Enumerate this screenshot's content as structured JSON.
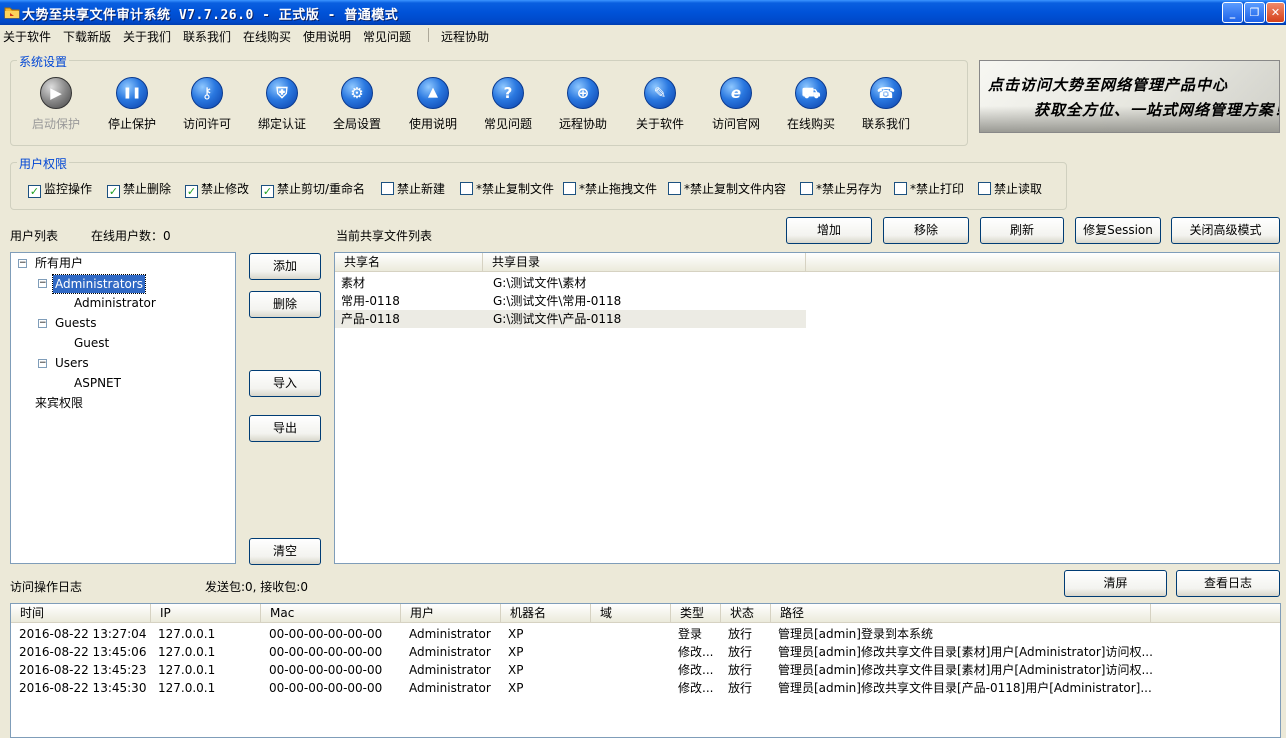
{
  "window": {
    "title": "大势至共享文件审计系统 V7.7.26.0 - 正式版 - 普通模式",
    "minimize": "_",
    "restore": "❐",
    "close": "✕"
  },
  "menu": {
    "items": [
      "关于软件",
      "下载新版",
      "关于我们",
      "联系我们",
      "在线购买",
      "使用说明",
      "常见问题",
      "远程协助"
    ]
  },
  "settings": {
    "group_title": "系统设置",
    "tools": [
      {
        "label": "启动保护",
        "icon": "play-icon",
        "glyph": "▶",
        "disabled": true
      },
      {
        "label": "停止保护",
        "icon": "pause-icon",
        "glyph": "❚❚",
        "disabled": false
      },
      {
        "label": "访问许可",
        "icon": "key-icon",
        "glyph": "⚷",
        "disabled": false
      },
      {
        "label": "绑定认证",
        "icon": "shield-icon",
        "glyph": "⛨",
        "disabled": false
      },
      {
        "label": "全局设置",
        "icon": "gear-icon",
        "glyph": "⚙",
        "disabled": false
      },
      {
        "label": "使用说明",
        "icon": "graduation-cap-icon",
        "glyph": "🎓",
        "disabled": false
      },
      {
        "label": "常见问题",
        "icon": "help-icon",
        "glyph": "?",
        "disabled": false
      },
      {
        "label": "远程协助",
        "icon": "globe-icon",
        "glyph": "⊕",
        "disabled": false
      },
      {
        "label": "关于软件",
        "icon": "document-icon",
        "glyph": "✎",
        "disabled": false
      },
      {
        "label": "访问官网",
        "icon": "ie-browser-icon",
        "glyph": "e",
        "disabled": false
      },
      {
        "label": "在线购买",
        "icon": "cart-icon",
        "glyph": "⛟",
        "disabled": false
      },
      {
        "label": "联系我们",
        "icon": "phone-icon",
        "glyph": "☎",
        "disabled": false
      }
    ]
  },
  "banner": {
    "line1": "点击访问大势至网络管理产品中心",
    "line2": "获取全方位、一站式网络管理方案！"
  },
  "permissions": {
    "group_title": "用户权限",
    "items": [
      {
        "label": "监控操作",
        "checked": true
      },
      {
        "label": "禁止删除",
        "checked": true
      },
      {
        "label": "禁止修改",
        "checked": true
      },
      {
        "label": "禁止剪切/重命名",
        "checked": true
      },
      {
        "label": "禁止新建",
        "checked": false
      },
      {
        "label": "*禁止复制文件",
        "checked": false
      },
      {
        "label": "*禁止拖拽文件",
        "checked": false
      },
      {
        "label": "*禁止复制文件内容",
        "checked": false
      },
      {
        "label": "*禁止另存为",
        "checked": false
      },
      {
        "label": "*禁止打印",
        "checked": false
      },
      {
        "label": "禁止读取",
        "checked": false
      }
    ]
  },
  "users": {
    "title": "用户列表",
    "online": "在线用户数：0",
    "tree": {
      "root": "所有用户",
      "groups": [
        {
          "name": "Administrators",
          "members": [
            "Administrator"
          ]
        },
        {
          "name": "Guests",
          "members": [
            "Guest"
          ]
        },
        {
          "name": "Users",
          "members": [
            "ASPNET"
          ]
        }
      ],
      "guest_rights": "来宾权限"
    },
    "buttons": {
      "add": "添加",
      "delete": "删除",
      "import": "导入",
      "export": "导出",
      "clear": "清空"
    }
  },
  "shares": {
    "title": "当前共享文件列表",
    "buttons": {
      "add": "增加",
      "remove": "移除",
      "refresh": "刷新",
      "fix_session": "修复Session",
      "close_advanced": "关闭高级模式"
    },
    "columns": [
      "共享名",
      "共享目录"
    ],
    "rows": [
      [
        "素材",
        "G:\\测试文件\\素材"
      ],
      [
        "常用-0118",
        "G:\\测试文件\\常用-0118"
      ],
      [
        "产品-0118",
        "G:\\测试文件\\产品-0118"
      ]
    ]
  },
  "log": {
    "title": "访问操作日志",
    "packets": "发送包:0, 接收包:0",
    "buttons": {
      "clear": "清屏",
      "view": "查看日志"
    },
    "columns": [
      "时间",
      "IP",
      "Mac",
      "用户",
      "机器名",
      "域",
      "类型",
      "状态",
      "路径"
    ],
    "rows": [
      [
        "2016-08-22 13:27:04",
        "127.0.0.1",
        "00-00-00-00-00-00",
        "Administrator",
        "XP",
        "",
        "登录",
        "放行",
        "管理员[admin]登录到本系统"
      ],
      [
        "2016-08-22 13:45:06",
        "127.0.0.1",
        "00-00-00-00-00-00",
        "Administrator",
        "XP",
        "",
        "修改...",
        "放行",
        "管理员[admin]修改共享文件目录[素材]用户[Administrator]访问权..."
      ],
      [
        "2016-08-22 13:45:23",
        "127.0.0.1",
        "00-00-00-00-00-00",
        "Administrator",
        "XP",
        "",
        "修改...",
        "放行",
        "管理员[admin]修改共享文件目录[素材]用户[Administrator]访问权..."
      ],
      [
        "2016-08-22 13:45:30",
        "127.0.0.1",
        "00-00-00-00-00-00",
        "Administrator",
        "XP",
        "",
        "修改...",
        "放行",
        "管理员[admin]修改共享文件目录[产品-0118]用户[Administrator]..."
      ]
    ]
  }
}
